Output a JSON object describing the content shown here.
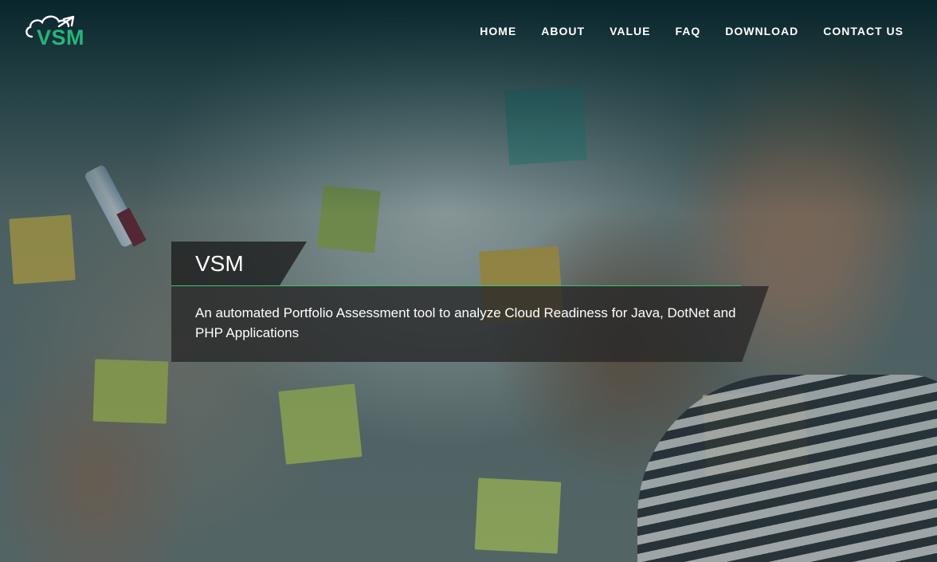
{
  "brand": {
    "logo_text": "VSM",
    "accent_color": "#27b57a",
    "logo_icon": "cloud-arrow-icon"
  },
  "nav": {
    "items": [
      {
        "label": "HOME"
      },
      {
        "label": "ABOUT"
      },
      {
        "label": "VALUE"
      },
      {
        "label": "FAQ"
      },
      {
        "label": "DOWNLOAD"
      },
      {
        "label": "CONTACT US"
      }
    ]
  },
  "hero": {
    "title": "VSM",
    "description": "An automated Portfolio Assessment tool to analyze Cloud Readiness for Java, DotNet and PHP Applications",
    "underline_color": "#34c86f"
  }
}
